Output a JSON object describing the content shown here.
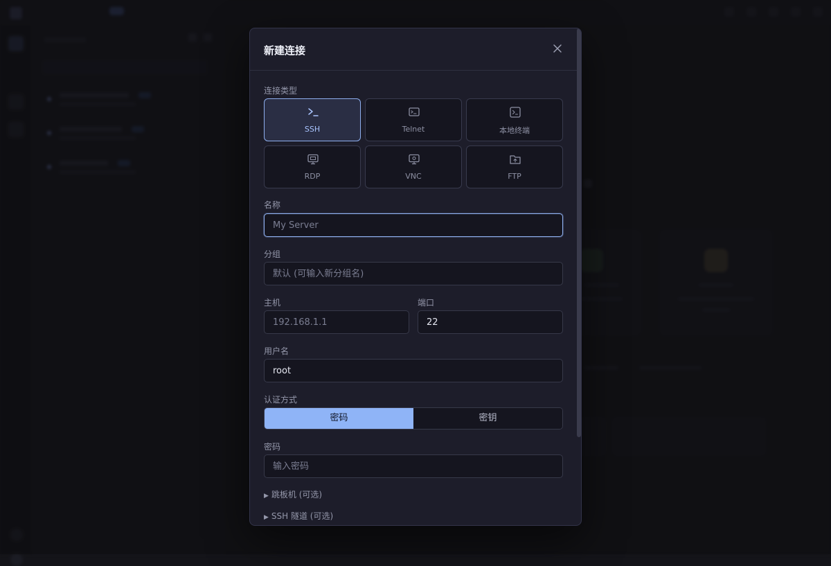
{
  "modal": {
    "title": "新建连接",
    "connection_type_label": "连接类型",
    "types": [
      {
        "label": "SSH",
        "icon": "terminal-prompt-icon",
        "active": true
      },
      {
        "label": "Telnet",
        "icon": "terminal-window-icon",
        "active": false
      },
      {
        "label": "本地终端",
        "icon": "local-terminal-icon",
        "active": false
      },
      {
        "label": "RDP",
        "icon": "remote-desktop-icon",
        "active": false
      },
      {
        "label": "VNC",
        "icon": "vnc-monitor-icon",
        "active": false
      },
      {
        "label": "FTP",
        "icon": "folder-upload-icon",
        "active": false
      }
    ],
    "name": {
      "label": "名称",
      "value": "",
      "placeholder": "My Server"
    },
    "group": {
      "label": "分组",
      "value": "",
      "placeholder": "默认 (可输入新分组名)"
    },
    "host": {
      "label": "主机",
      "value": "",
      "placeholder": "192.168.1.1"
    },
    "port": {
      "label": "端口",
      "value": "22"
    },
    "username": {
      "label": "用户名",
      "value": "root"
    },
    "auth": {
      "label": "认证方式",
      "options": [
        "密码",
        "密钥"
      ],
      "selected": "密码"
    },
    "password": {
      "label": "密码",
      "value": "",
      "placeholder": "输入密码"
    },
    "jump_host": "跳板机 (可选)",
    "ssh_tunnel": "SSH 隧道 (可选)"
  },
  "colors": {
    "accent": "#8fb4f7",
    "modal_bg": "#1d1d2a",
    "backdrop": "#141419"
  }
}
